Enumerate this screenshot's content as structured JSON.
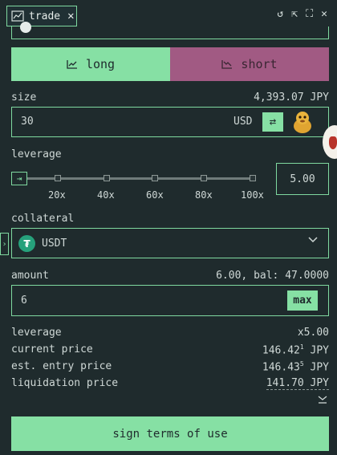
{
  "header": {
    "tab_label": "trade",
    "icons": [
      "chart-icon",
      "close-icon",
      "refresh-icon",
      "external-link-icon",
      "expand-icon",
      "close-panel-icon"
    ]
  },
  "toggle": {
    "long_label": "long",
    "short_label": "short"
  },
  "size": {
    "label": "size",
    "converted": "4,393.07 JPY",
    "value": "30",
    "currency": "USD"
  },
  "leverage": {
    "label": "leverage",
    "value": "5.00",
    "ticks": [
      "20x",
      "40x",
      "60x",
      "80x",
      "100x"
    ],
    "level_fraction": 0
  },
  "collateral": {
    "label": "collateral",
    "value": "USDT",
    "token_icon": "tether-icon"
  },
  "amount": {
    "label": "amount",
    "balance": "6.00, bal: 47.0000",
    "value": "6",
    "max_label": "max"
  },
  "summary": {
    "leverage_label": "leverage",
    "leverage_value": "x5.00",
    "current_label": "current price",
    "current_main": "146.42",
    "current_sup": "1",
    "current_unit": "JPY",
    "entry_label": "est. entry price",
    "entry_main": "146.43",
    "entry_sup": "5",
    "entry_unit": "JPY",
    "liq_label": "liquidation price",
    "liq_value": "141.70 JPY"
  },
  "actions": {
    "sign_label": "sign terms of use"
  },
  "colors": {
    "accent": "#86e0a4",
    "short": "#a15a83",
    "background": "#1f2b2d"
  }
}
